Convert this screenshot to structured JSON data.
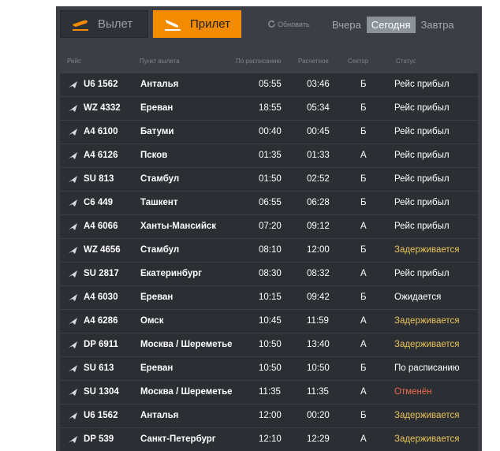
{
  "tabs": {
    "departure_label": "Вылет",
    "arrival_label": "Прилет",
    "refresh_label": "Обновить",
    "days": [
      "Вчера",
      "Сегодня",
      "Завтра"
    ],
    "active_day": 1
  },
  "headers": {
    "flight": "Рейс",
    "origin": "Пункт вылета",
    "scheduled": "По расписанию",
    "estimated": "Расчетное",
    "sector": "Сектор",
    "status": "Статус"
  },
  "flights": [
    {
      "flight": "U6 1562",
      "city": "Анталья",
      "scheduled": "05:55",
      "estimated": "03:46",
      "sector": "Б",
      "status": "Рейс прибыл",
      "status_kind": "arrived"
    },
    {
      "flight": "WZ 4332",
      "city": "Ереван",
      "scheduled": "18:55",
      "estimated": "05:34",
      "sector": "Б",
      "status": "Рейс прибыл",
      "status_kind": "arrived"
    },
    {
      "flight": "A4 6100",
      "city": "Батуми",
      "scheduled": "00:40",
      "estimated": "00:45",
      "sector": "Б",
      "status": "Рейс прибыл",
      "status_kind": "arrived"
    },
    {
      "flight": "A4 6126",
      "city": "Псков",
      "scheduled": "01:35",
      "estimated": "01:33",
      "sector": "А",
      "status": "Рейс прибыл",
      "status_kind": "arrived"
    },
    {
      "flight": "SU 813",
      "city": "Стамбул",
      "scheduled": "01:50",
      "estimated": "02:52",
      "sector": "Б",
      "status": "Рейс прибыл",
      "status_kind": "arrived"
    },
    {
      "flight": "C6 449",
      "city": "Ташкент",
      "scheduled": "06:55",
      "estimated": "06:28",
      "sector": "Б",
      "status": "Рейс прибыл",
      "status_kind": "arrived"
    },
    {
      "flight": "A4 6066",
      "city": "Ханты-Мансийск",
      "scheduled": "07:20",
      "estimated": "09:12",
      "sector": "А",
      "status": "Рейс прибыл",
      "status_kind": "arrived"
    },
    {
      "flight": "WZ 4656",
      "city": "Стамбул",
      "scheduled": "08:10",
      "estimated": "12:00",
      "sector": "Б",
      "status": "Задерживается",
      "status_kind": "delayed"
    },
    {
      "flight": "SU 2817",
      "city": "Екатеринбург",
      "scheduled": "08:30",
      "estimated": "08:32",
      "sector": "А",
      "status": "Рейс прибыл",
      "status_kind": "arrived"
    },
    {
      "flight": "A4 6030",
      "city": "Ереван",
      "scheduled": "10:15",
      "estimated": "09:42",
      "sector": "Б",
      "status": "Ожидается",
      "status_kind": "normal"
    },
    {
      "flight": "A4 6286",
      "city": "Омск",
      "scheduled": "10:45",
      "estimated": "11:59",
      "sector": "А",
      "status": "Задерживается",
      "status_kind": "delayed"
    },
    {
      "flight": "DP 6911",
      "city": "Москва / Шереметьево",
      "scheduled": "10:50",
      "estimated": "13:40",
      "sector": "А",
      "status": "Задерживается",
      "status_kind": "delayed"
    },
    {
      "flight": "SU 613",
      "city": "Ереван",
      "scheduled": "10:50",
      "estimated": "10:50",
      "sector": "Б",
      "status": "По расписанию",
      "status_kind": "normal"
    },
    {
      "flight": "SU 1304",
      "city": "Москва / Шереметьево",
      "scheduled": "11:35",
      "estimated": "11:35",
      "sector": "А",
      "status": "Отменён",
      "status_kind": "cancel"
    },
    {
      "flight": "U6 1562",
      "city": "Анталья",
      "scheduled": "12:00",
      "estimated": "00:20",
      "sector": "Б",
      "status": "Задерживается",
      "status_kind": "delayed"
    },
    {
      "flight": "DP 539",
      "city": "Санкт-Петербург",
      "scheduled": "12:10",
      "estimated": "12:29",
      "sector": "А",
      "status": "Задерживается",
      "status_kind": "delayed"
    }
  ],
  "colors": {
    "accent": "#f28b00",
    "delayed": "#e8c35a",
    "cancelled": "#ef6a4e"
  }
}
